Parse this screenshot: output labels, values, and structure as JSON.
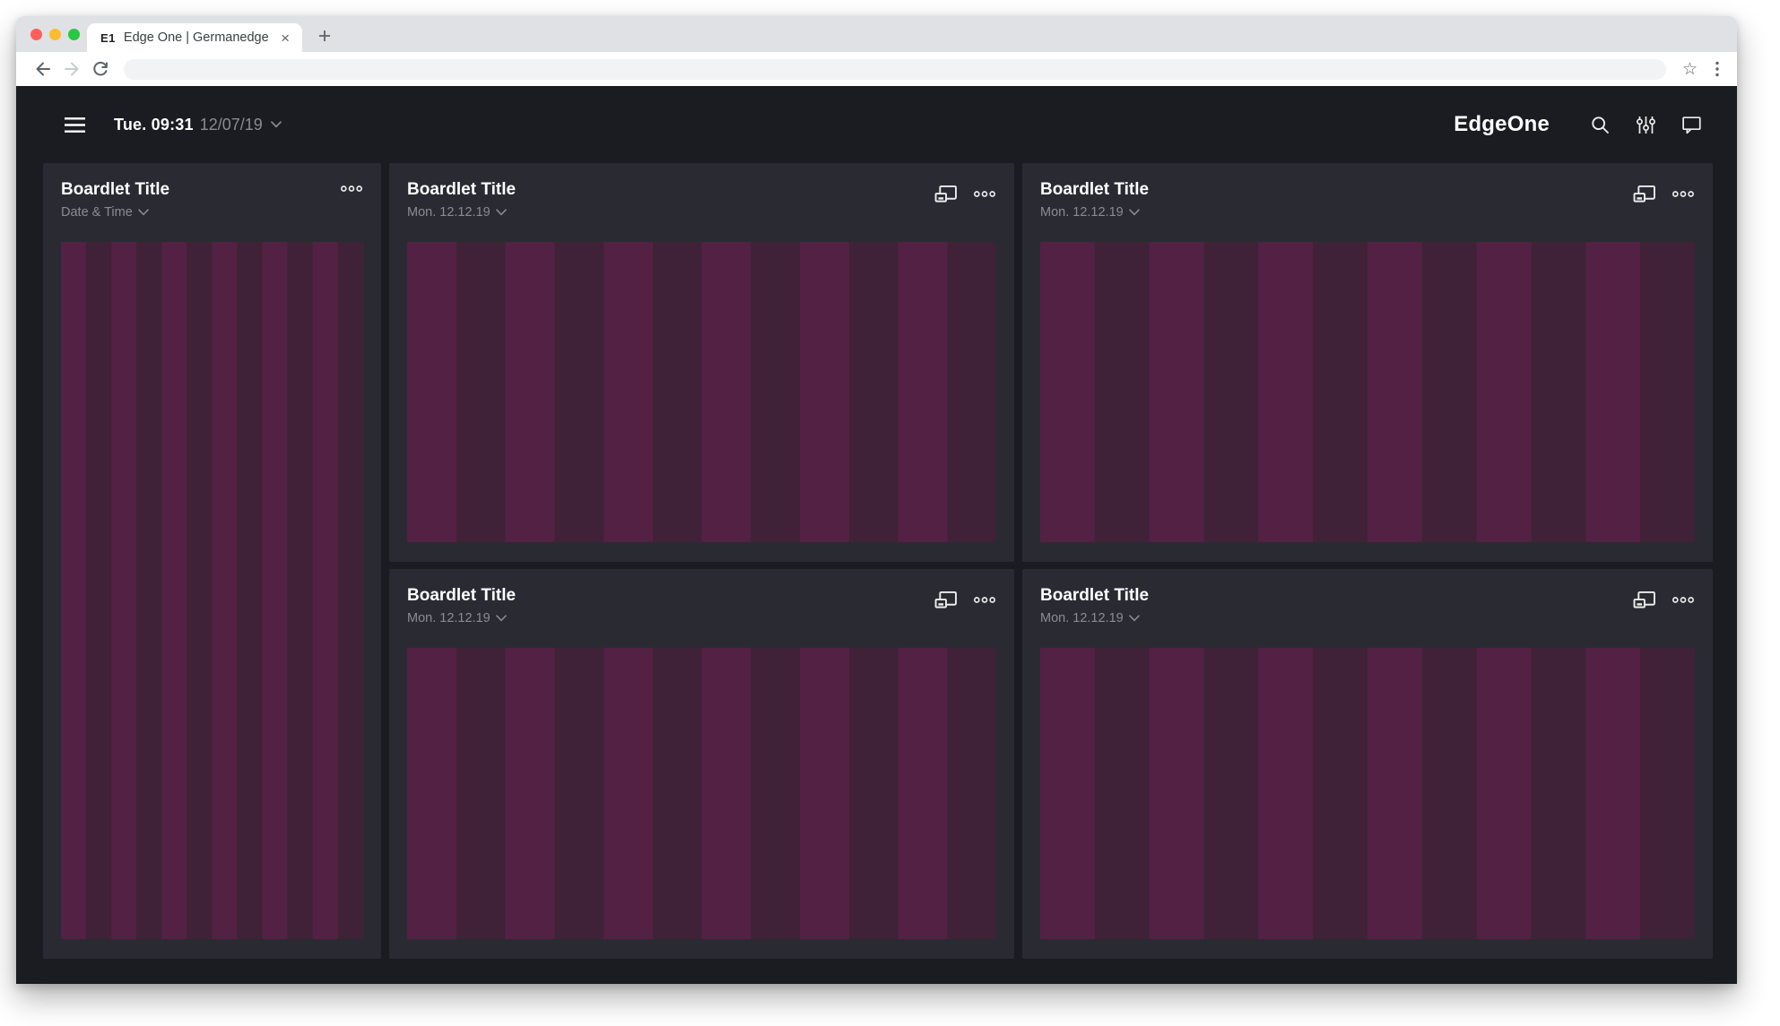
{
  "browser": {
    "tab": {
      "favicon_text": "E1",
      "title": "Edge One | Germanedge",
      "close_label": "×"
    },
    "url_value": "",
    "window_buttons": [
      "close",
      "minimize",
      "zoom"
    ]
  },
  "app_header": {
    "time": "Tue. 09:31",
    "date": "12/07/19",
    "logo": "EdgeOne"
  },
  "cards": [
    {
      "title": "Boardlet Title",
      "subtitle": "Date & Time"
    },
    {
      "title": "Boardlet Title",
      "subtitle": "Mon. 12.12.19"
    },
    {
      "title": "Boardlet Title",
      "subtitle": "Mon. 12.12.19"
    },
    {
      "title": "Boardlet Title",
      "subtitle": "Mon. 12.12.19"
    },
    {
      "title": "Boardlet Title",
      "subtitle": "Mon. 12.12.19"
    }
  ],
  "icons": {
    "menu": "hamburger",
    "search": "magnifier",
    "filter": "vertical-sliders",
    "chat": "speech-bubble",
    "popout": "pip-window",
    "more": "ellipsis-circles",
    "chevron": "chevron-down",
    "back": "arrow-left",
    "forward": "arrow-right",
    "reload": "refresh",
    "bookmark": "star",
    "browser_menu": "kebab-dots",
    "new_tab": "plus"
  },
  "theme": {
    "app-bg": "#1b1c21",
    "card-bg": "#2a2b32",
    "stripe-light": "#522144",
    "stripe-dark": "#3f2237",
    "title-color": "#ffffff",
    "subtitle-color": "#898c92",
    "tabstrip-bg": "#dfe1e5",
    "chrome-bg": "#ffffff",
    "urlbar-bg": "#f1f3f4",
    "traffic-red": "#ff5f57",
    "traffic-yellow": "#febc2e",
    "traffic-green": "#28c840"
  }
}
